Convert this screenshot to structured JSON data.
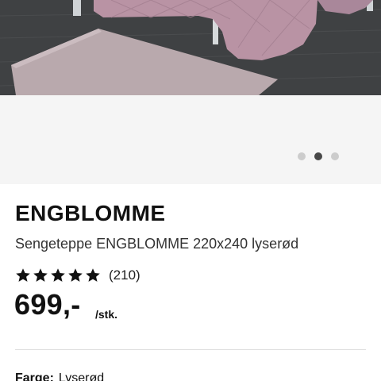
{
  "product": {
    "name": "ENGBLOMME",
    "description": "Sengeteppe ENGBLOMME 220x240 lyserød",
    "rating": 5,
    "review_count": "(210)",
    "price": "699,-",
    "unit": "/stk."
  },
  "carousel": {
    "slide_count": 3,
    "active_index": 1
  },
  "attributes": {
    "color_label": "Farge:",
    "color_value": "Lyserød"
  },
  "icons": {
    "rating": "star-icon"
  },
  "colors": {
    "carousel_bg": "#f5f5f5",
    "dot_active": "#484848",
    "dot_inactive": "#cccccc",
    "bedspread_pink": "#b993a4",
    "rug_pink": "#b9a9ad",
    "floor": "#3d3f41"
  }
}
